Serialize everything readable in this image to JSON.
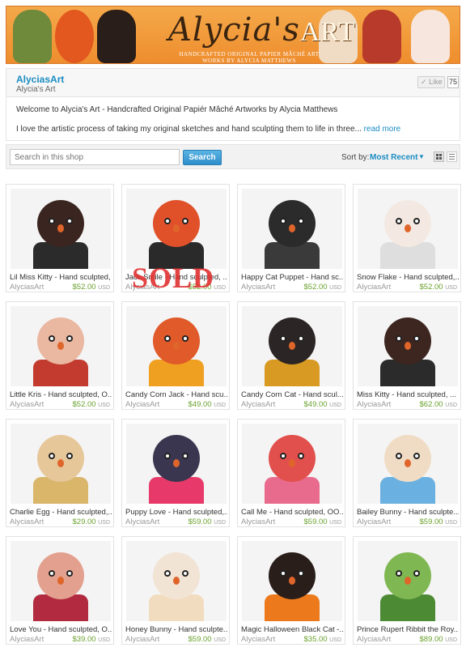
{
  "banner": {
    "logo_main": "Alycia's",
    "logo_accent": "ART",
    "tagline": "HANDCRAFTED ORIGINAL PAPIER MÂCHÉ ART WORKS BY ALYCIA MATTHEWS"
  },
  "shop": {
    "name": "AlyciasArt",
    "subtitle": "Alycia's Art",
    "like_label": "Like",
    "like_count": "75",
    "welcome": "Welcome to Alycia's Art - Handcrafted Original Papiér Mâché Artworks by Alycia Matthews",
    "about": "I love the artistic process of taking my original sketches and hand sculpting them to life in three...",
    "read_more": "read more"
  },
  "search": {
    "placeholder": "Search in this shop",
    "button": "Search",
    "sort_label": "Sort by:",
    "sort_value": "Most Recent"
  },
  "sold_stamp": "SOLD",
  "listings": [
    {
      "title": "Lil Miss Kitty - Hand sculpted, ...",
      "shop": "AlyciasArt",
      "price": "$52.00",
      "currency": "USD",
      "head": "#3a2520",
      "body": "#2b2b2b",
      "bg": "#f4f4f4"
    },
    {
      "title": "Jack Smile - Hand sculpted, ...",
      "shop": "AlyciasArt",
      "price": "$52.00",
      "currency": "USD",
      "head": "#e0512a",
      "body": "#2a2a2a",
      "bg": "#f4f4f4"
    },
    {
      "title": "Happy Cat Puppet - Hand sc...",
      "shop": "AlyciasArt",
      "price": "$52.00",
      "currency": "USD",
      "head": "#2b2b2b",
      "body": "#3a3a3a",
      "bg": "#f4f4f4"
    },
    {
      "title": "Snow Flake - Hand sculpted,...",
      "shop": "AlyciasArt",
      "price": "$52.00",
      "currency": "USD",
      "head": "#f3e9e2",
      "body": "#dedede",
      "bg": "#f4f4f4"
    },
    {
      "title": "Little Kris - Hand sculpted, O...",
      "shop": "AlyciasArt",
      "price": "$52.00",
      "currency": "USD",
      "head": "#eab7a0",
      "body": "#c23b2e",
      "bg": "#f4f4f4"
    },
    {
      "title": "Candy Corn Jack - Hand scu...",
      "shop": "AlyciasArt",
      "price": "$49.00",
      "currency": "USD",
      "head": "#e05a2a",
      "body": "#f0a020",
      "bg": "#f4f4f4"
    },
    {
      "title": "Candy Corn Cat - Hand scul...",
      "shop": "AlyciasArt",
      "price": "$49.00",
      "currency": "USD",
      "head": "#2b2625",
      "body": "#d89a22",
      "bg": "#f4f4f4"
    },
    {
      "title": "Miss Kitty - Hand sculpted, ...",
      "shop": "AlyciasArt",
      "price": "$62.00",
      "currency": "USD",
      "head": "#3d2620",
      "body": "#2b2b2b",
      "bg": "#f4f4f4"
    },
    {
      "title": "Charlie Egg - Hand sculpted,...",
      "shop": "AlyciasArt",
      "price": "$29.00",
      "currency": "USD",
      "head": "#e6c79a",
      "body": "#d9b66a",
      "bg": "#f4f4f4"
    },
    {
      "title": "Puppy Love - Hand sculpted,...",
      "shop": "AlyciasArt",
      "price": "$59.00",
      "currency": "USD",
      "head": "#3a3650",
      "body": "#e73a6a",
      "bg": "#f4f4f4"
    },
    {
      "title": "Call Me - Hand sculpted, OO...",
      "shop": "AlyciasArt",
      "price": "$59.00",
      "currency": "USD",
      "head": "#e2504e",
      "body": "#e86a8c",
      "bg": "#f4f4f4"
    },
    {
      "title": "Bailey Bunny - Hand sculpte...",
      "shop": "AlyciasArt",
      "price": "$59.00",
      "currency": "USD",
      "head": "#f0dcc4",
      "body": "#6ab0e0",
      "bg": "#f4f4f4"
    },
    {
      "title": "Love You - Hand sculpted, O...",
      "shop": "AlyciasArt",
      "price": "$39.00",
      "currency": "USD",
      "head": "#e3a08e",
      "body": "#b22a40",
      "bg": "#f4f4f4"
    },
    {
      "title": "Honey Bunny - Hand sculpte...",
      "shop": "AlyciasArt",
      "price": "$59.00",
      "currency": "USD",
      "head": "#f2e4d4",
      "body": "#f2dcc0",
      "bg": "#f4f4f4"
    },
    {
      "title": "Magic Halloween Black Cat -...",
      "shop": "AlyciasArt",
      "price": "$35.00",
      "currency": "USD",
      "head": "#2a1e1a",
      "body": "#ec7a1c",
      "bg": "#f4f4f4"
    },
    {
      "title": "Prince Rupert Ribbit the Roy...",
      "shop": "AlyciasArt",
      "price": "$89.00",
      "currency": "USD",
      "head": "#7fb852",
      "body": "#4c8a34",
      "bg": "#f4f4f4"
    }
  ]
}
